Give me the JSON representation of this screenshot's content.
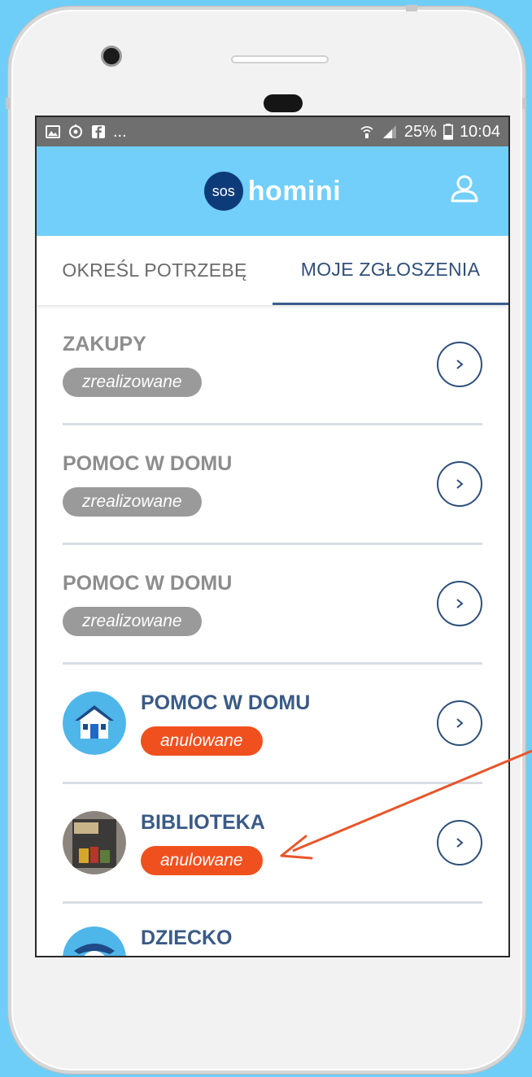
{
  "status_bar": {
    "notifications_more": "...",
    "battery": "25%",
    "time": "10:04"
  },
  "app": {
    "logo_badge": "sos",
    "logo_text": "homini"
  },
  "tabs": [
    {
      "label": "OKREŚL POTRZEBĘ",
      "active": false
    },
    {
      "label": "MOJE ZGŁOSZENIA",
      "active": true
    }
  ],
  "requests": [
    {
      "title": "ZAKUPY",
      "status": "zrealizowane",
      "status_color": "#9a9a9a",
      "avatar": null
    },
    {
      "title": "POMOC W DOMU",
      "status": "zrealizowane",
      "status_color": "#9a9a9a",
      "avatar": null
    },
    {
      "title": "POMOC W DOMU",
      "status": "zrealizowane",
      "status_color": "#9a9a9a",
      "avatar": null
    },
    {
      "title": "POMOC W DOMU",
      "status": "anulowane",
      "status_color": "#f0501e",
      "avatar": "house-icon"
    },
    {
      "title": "BIBLIOTEKA",
      "status": "anulowane",
      "status_color": "#f0501e",
      "avatar": "book-photo"
    },
    {
      "title": "DZIECKO",
      "status": "",
      "status_color": "",
      "avatar": "child-icon"
    }
  ],
  "colors": {
    "background": "#6fcef7",
    "appbar": "#71cff9",
    "accent_dark": "#2f4f7a",
    "inactive_title": "#8d8d8d",
    "active_title": "#3a5a86",
    "done_badge": "#9a9a9a",
    "cancel_badge": "#f0501e",
    "arrow": "#e8552a"
  }
}
